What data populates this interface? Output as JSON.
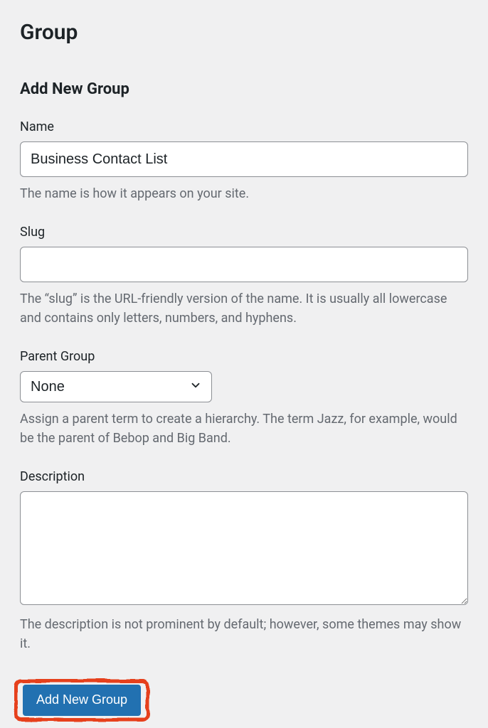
{
  "page": {
    "title": "Group"
  },
  "form": {
    "section_title": "Add New Group",
    "name": {
      "label": "Name",
      "value": "Business Contact List",
      "helper": "The name is how it appears on your site."
    },
    "slug": {
      "label": "Slug",
      "value": "",
      "helper": "The “slug” is the URL-friendly version of the name. It is usually all lowercase and contains only letters, numbers, and hyphens."
    },
    "parent_group": {
      "label": "Parent Group",
      "selected": "None",
      "helper": "Assign a parent term to create a hierarchy. The term Jazz, for example, would be the parent of Bebop and Big Band."
    },
    "description": {
      "label": "Description",
      "value": "",
      "helper": "The description is not prominent by default; however, some themes may show it."
    },
    "submit_label": "Add New Group"
  }
}
